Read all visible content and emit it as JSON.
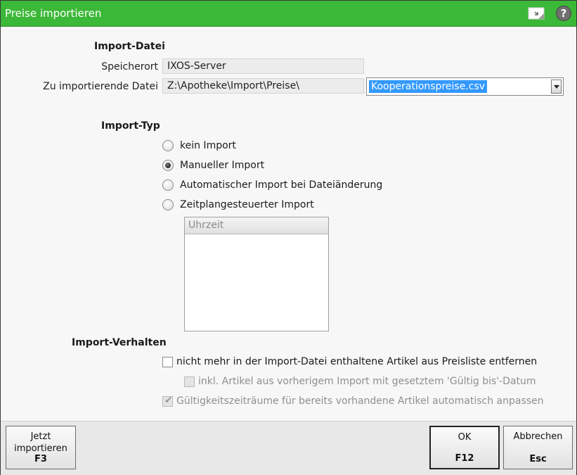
{
  "window": {
    "title": "Preise importieren"
  },
  "import_file": {
    "section_title": "Import-Datei",
    "storage_label": "Speicherort",
    "storage_value": "IXOS-Server",
    "file_label": "Zu importierende Datei",
    "path_value": "Z:\\Apotheke\\Import\\Preise\\",
    "file_selected": "Kooperationspreise.csv"
  },
  "import_type": {
    "section_title": "Import-Typ",
    "options": [
      {
        "label": "kein Import",
        "checked": false
      },
      {
        "label": "Manueller Import",
        "checked": true
      },
      {
        "label": "Automatischer Import bei Dateiänderung",
        "checked": false
      },
      {
        "label": "Zeitplangesteuerter Import",
        "checked": false
      }
    ],
    "schedule_header": "Uhrzeit"
  },
  "import_behavior": {
    "section_title": "Import-Verhalten",
    "remove_label": "nicht mehr in der Import-Datei enthaltene Artikel aus Preisliste entfernen",
    "include_label": "inkl. Artikel aus vorherigem Import mit gesetztem 'Gültig bis'-Datum",
    "adjust_label": "Gültigkeitszeiträume für bereits vorhandene Artikel automatisch anpassen"
  },
  "footer": {
    "import_now_line1": "Jetzt",
    "import_now_line2": "importieren",
    "import_now_key": "F3",
    "ok_label": "OK",
    "ok_key": "F12",
    "cancel_label": "Abbrechen",
    "cancel_key": "Esc"
  },
  "colors": {
    "titlebar": "#3cb838",
    "selection": "#3399ff"
  }
}
